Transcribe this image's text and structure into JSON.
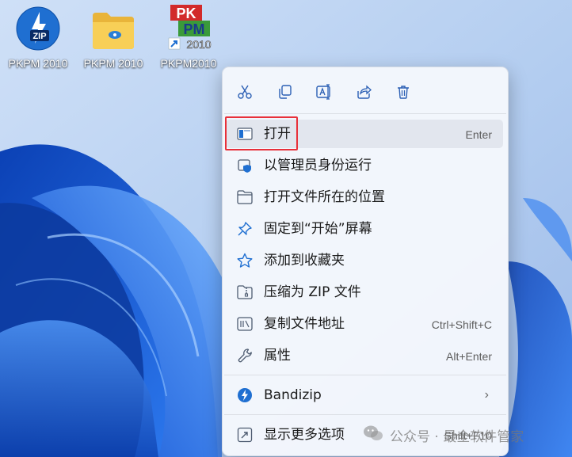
{
  "desktop": {
    "icons": [
      {
        "label": "PKPM 2010",
        "icon": "zip-shortcut-icon",
        "badge": "ZIP"
      },
      {
        "label": "PKPM 2010",
        "icon": "folder-icon"
      },
      {
        "label": "PKPM2010",
        "icon": "pkpm-app-icon",
        "logo_top": "PK",
        "logo_mid": "PM",
        "logo_bottom": "2010"
      }
    ]
  },
  "context_menu": {
    "toolbar": [
      {
        "icon": "cut-icon"
      },
      {
        "icon": "copy-icon"
      },
      {
        "icon": "rename-icon"
      },
      {
        "icon": "share-icon"
      },
      {
        "icon": "delete-icon"
      }
    ],
    "items": [
      {
        "label": "打开",
        "shortcut": "Enter",
        "icon": "open-app-icon"
      },
      {
        "label": "以管理员身份运行",
        "shortcut": "",
        "icon": "shield-icon"
      },
      {
        "label": "打开文件所在的位置",
        "shortcut": "",
        "icon": "folder-outline-icon"
      },
      {
        "label": "固定到“开始”屏幕",
        "shortcut": "",
        "icon": "pin-icon"
      },
      {
        "label": "添加到收藏夹",
        "shortcut": "",
        "icon": "star-icon"
      },
      {
        "label": "压缩为 ZIP 文件",
        "shortcut": "",
        "icon": "zip-folder-icon"
      },
      {
        "label": "复制文件地址",
        "shortcut": "Ctrl+Shift+C",
        "icon": "copy-path-icon"
      },
      {
        "label": "属性",
        "shortcut": "Alt+Enter",
        "icon": "wrench-icon"
      },
      {
        "label": "Bandizip",
        "shortcut": "",
        "icon": "bandizip-icon",
        "submenu": "›"
      },
      {
        "label": "显示更多选项",
        "shortcut": "Shift+F10",
        "icon": "more-options-icon"
      }
    ]
  },
  "watermark": {
    "text": "公众号 · 最全软件管家"
  },
  "colors": {
    "accent": "#0f6cbd",
    "highlight_border": "#e8303a"
  }
}
